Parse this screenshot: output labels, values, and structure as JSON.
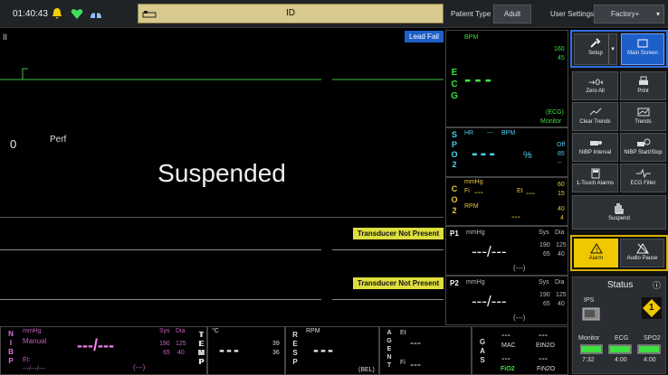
{
  "topbar": {
    "time": "01:40:43",
    "id_label": "ID",
    "patient_type_label": "Patient Type",
    "patient_type_value": "Adult",
    "user_settings_label": "User Settings",
    "user_settings_value": "Factory+"
  },
  "wave": {
    "lead": "II",
    "lead_fail": "Lead Fail",
    "perf_value": "0",
    "perf_label": "Perf",
    "suspended": "Suspended",
    "transducer_p1": "Transducer Not Present",
    "transducer_p2": "Transducer Not Present"
  },
  "ecg": {
    "label": "ECG",
    "bpm": "BPM",
    "hi": "160",
    "lo": "45",
    "mode": "(ECG)",
    "sub": "Monitor",
    "value": "---"
  },
  "spo2": {
    "label": "SPO2",
    "hr": "HR",
    "hr_val": "---",
    "bpm": "BPM",
    "off": "Off",
    "hi": "85",
    "lo": "--",
    "value": "---",
    "pct": "%"
  },
  "co2": {
    "label": "CO2",
    "mmhg": "mmHg",
    "fi": "Fi",
    "fi_val": "---",
    "et": "Et",
    "et_val": "---",
    "hi1": "60",
    "lo1": "15",
    "rpm": "RPM",
    "rpm_val": "---",
    "hi2": "40",
    "lo2": "4"
  },
  "p1": {
    "label": "P1",
    "mmhg": "mmHg",
    "sys": "Sys",
    "dia": "Dia",
    "value": "---/---",
    "mean": "(---)",
    "s_hi": "190",
    "s_lo": "65",
    "d_hi": "125",
    "d_lo": "40"
  },
  "p2": {
    "label": "P2",
    "mmhg": "mmHg",
    "sys": "Sys",
    "dia": "Dia",
    "value": "---/---",
    "mean": "(---)",
    "s_hi": "190",
    "s_lo": "65",
    "d_hi": "125",
    "d_lo": "40"
  },
  "nibp": {
    "label": "NIBP",
    "mmhg": "mmHg",
    "mode": "Manual",
    "et": "Et:",
    "time": "---/---/---",
    "sys": "Sys",
    "dia": "Dia",
    "value": "---/---",
    "mean": "(---)",
    "s_hi": "190",
    "s_lo": "65",
    "d_hi": "125",
    "d_lo": "40"
  },
  "temp": {
    "label": "TEMP",
    "unit": "°C",
    "value": "---",
    "hi": "39",
    "lo": "36"
  },
  "resp": {
    "label": "RESP",
    "unit": "RPM",
    "value": "---",
    "mode": "(BEL)"
  },
  "agent": {
    "label": "AGENT",
    "et": "Et",
    "et_val": "---",
    "fi": "Fi",
    "fi_val": "---"
  },
  "gas": {
    "label": "GAS",
    "v1": "---",
    "mac": "MAC",
    "v2": "---",
    "etn2o": "EtN2O",
    "v3": "---",
    "fio2": "FiO2",
    "v4": "---",
    "fin2o": "FiN2O"
  },
  "menu": {
    "setup": "Setup",
    "main_screen": "Main Screen",
    "zero_all": "Zero All",
    "print": "Print",
    "clear_trends": "Clear Trends",
    "trends": "Trends",
    "nibp_interval": "NIBP Interval",
    "nibp_start": "NIBP Start/Stop",
    "one_touch": "1-Touch Alarms",
    "ecg_filter": "ECG Filter",
    "suspend": "Suspend",
    "alarm": "Alarm",
    "audio_pause": "Audio Pause"
  },
  "status": {
    "title": "Status",
    "ips": "IPS",
    "monitor": "Monitor",
    "ecg": "ECG",
    "spo2": "SPO2",
    "t1": "7:32",
    "t2": "4:00",
    "t3": "4:00",
    "badge": "1"
  }
}
